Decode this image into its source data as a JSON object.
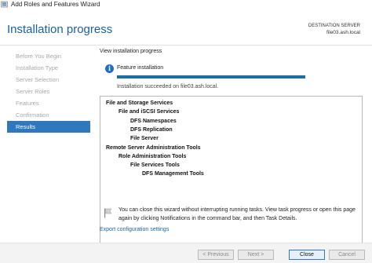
{
  "window": {
    "title": "Add Roles and Features Wizard"
  },
  "header": {
    "page_title": "Installation progress",
    "destination_label": "DESTINATION SERVER",
    "destination_value": "file03.ash.local"
  },
  "sidebar": {
    "items": [
      {
        "label": "Before You Begin",
        "active": false
      },
      {
        "label": "Installation Type",
        "active": false
      },
      {
        "label": "Server Selection",
        "active": false
      },
      {
        "label": "Server Roles",
        "active": false
      },
      {
        "label": "Features",
        "active": false
      },
      {
        "label": "Confirmation",
        "active": false
      },
      {
        "label": "Results",
        "active": true
      }
    ]
  },
  "main": {
    "view_progress_label": "View installation progress",
    "feature_label": "Feature installation",
    "progress_percent": 100,
    "success_text": "Installation succeeded on file03.ash.local.",
    "results": [
      {
        "text": "File and Storage Services",
        "level": 0,
        "bold": true
      },
      {
        "text": "File and iSCSI Services",
        "level": 1,
        "bold": true
      },
      {
        "text": "DFS Namespaces",
        "level": 2,
        "bold": true
      },
      {
        "text": "DFS Replication",
        "level": 2,
        "bold": true
      },
      {
        "text": "File Server",
        "level": 2,
        "bold": true
      },
      {
        "text": "Remote Server Administration Tools",
        "level": 0,
        "bold": true
      },
      {
        "text": "Role Administration Tools",
        "level": 1,
        "bold": true
      },
      {
        "text": "File Services Tools",
        "level": 2,
        "bold": true
      },
      {
        "text": "DFS Management Tools",
        "level": 3,
        "bold": true
      }
    ],
    "note_text": "You can close this wizard without interrupting running tasks. View task progress or open this page again by clicking Notifications in the command bar, and then Task Details.",
    "export_link": "Export configuration settings"
  },
  "footer": {
    "previous_label": "< Previous",
    "next_label": "Next >",
    "close_label": "Close",
    "cancel_label": "Cancel"
  },
  "colors": {
    "accent": "#2f78bd",
    "title_blue": "#1a5f9e",
    "progress_fill": "#1c6ea4"
  }
}
